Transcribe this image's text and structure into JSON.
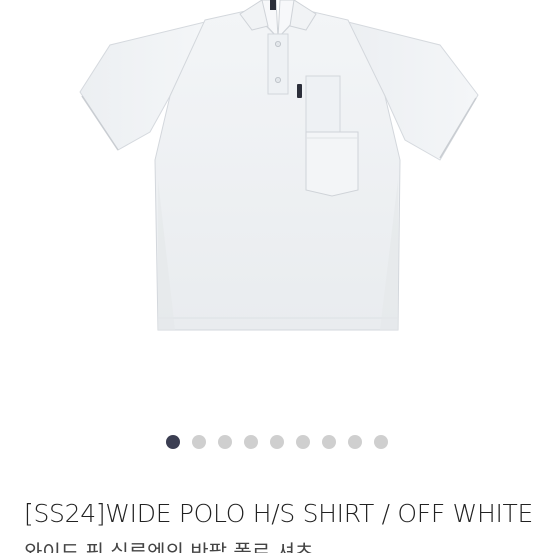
{
  "product": {
    "image_alt": "WIDE POLO H/S SHIRT OFF WHITE",
    "title": "[SS24]WIDE POLO H/S SHIRT / OFF WHITE",
    "subtitle": "와이드 핏 실루엣의 반팔 폴로 셔츠"
  },
  "carousel": {
    "dot_count": 9,
    "active_index": 0,
    "active_color": "#3b3e52",
    "inactive_color": "#cfcfcf"
  }
}
